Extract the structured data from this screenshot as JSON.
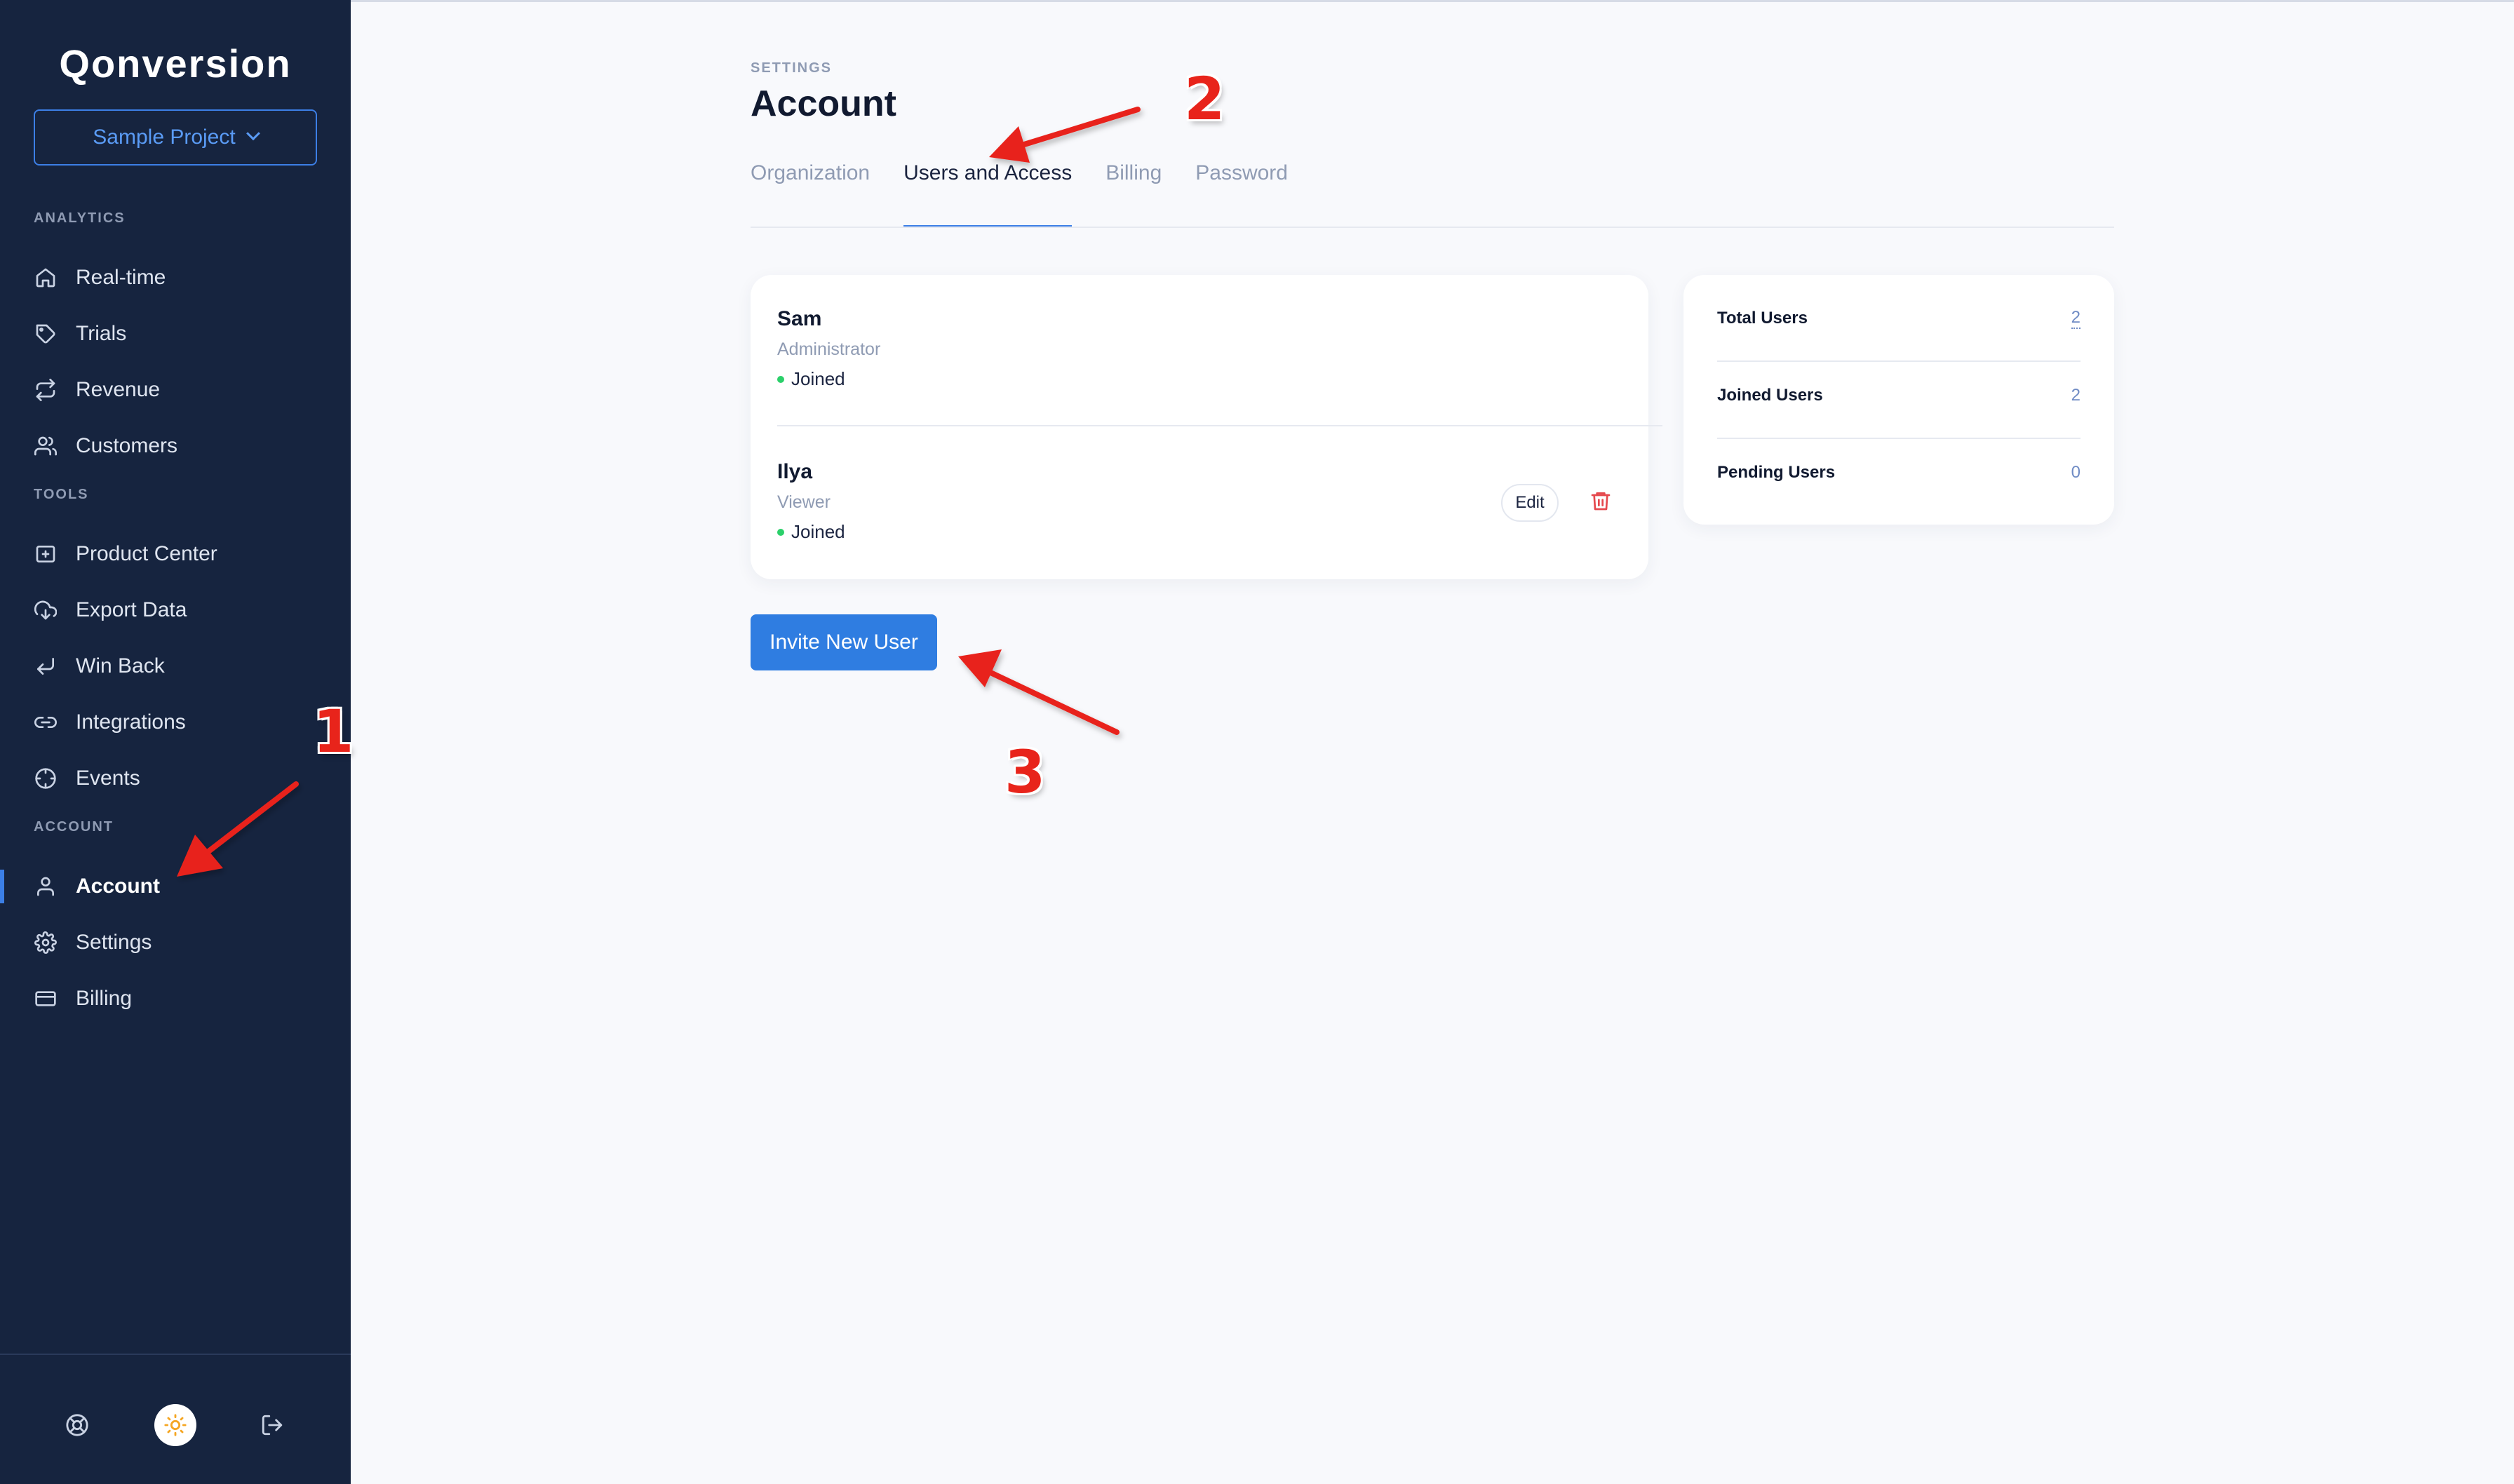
{
  "app": {
    "logo": "Qonversion",
    "project_selector": "Sample Project"
  },
  "sidebar": {
    "sections": {
      "analytics": "ANALYTICS",
      "tools": "TOOLS",
      "account": "ACCOUNT"
    },
    "items": [
      {
        "label": "Real-time",
        "icon": "home-icon"
      },
      {
        "label": "Trials",
        "icon": "tag-icon"
      },
      {
        "label": "Revenue",
        "icon": "repeat-icon"
      },
      {
        "label": "Customers",
        "icon": "users-icon"
      },
      {
        "label": "Product Center",
        "icon": "folder-plus-icon"
      },
      {
        "label": "Export Data",
        "icon": "cloud-download-icon"
      },
      {
        "label": "Win Back",
        "icon": "corner-down-left-icon"
      },
      {
        "label": "Integrations",
        "icon": "link-icon"
      },
      {
        "label": "Events",
        "icon": "crosshair-icon"
      },
      {
        "label": "Account",
        "icon": "user-icon",
        "active": true
      },
      {
        "label": "Settings",
        "icon": "gear-icon"
      },
      {
        "label": "Billing",
        "icon": "credit-card-icon"
      }
    ],
    "bottom_icons": [
      "help-icon",
      "sun-icon",
      "logout-icon"
    ]
  },
  "page": {
    "breadcrumb": "SETTINGS",
    "title": "Account",
    "tabs": [
      {
        "label": "Organization"
      },
      {
        "label": "Users and Access",
        "active": true
      },
      {
        "label": "Billing"
      },
      {
        "label": "Password"
      }
    ]
  },
  "users": [
    {
      "name": "Sam",
      "role": "Administrator",
      "status": "Joined"
    },
    {
      "name": "Ilya",
      "role": "Viewer",
      "status": "Joined"
    }
  ],
  "actions": {
    "edit": "Edit",
    "invite": "Invite New User"
  },
  "stats": [
    {
      "label": "Total Users",
      "value": "2"
    },
    {
      "label": "Joined Users",
      "value": "2"
    },
    {
      "label": "Pending Users",
      "value": "0"
    }
  ],
  "annotations": {
    "one": "1",
    "two": "2",
    "three": "3"
  },
  "colors": {
    "sidebar_bg": "#16243f",
    "accent": "#2f7de1",
    "status_joined": "#2bd06a",
    "delete": "#e5484d",
    "annotation": "#e8241b"
  }
}
